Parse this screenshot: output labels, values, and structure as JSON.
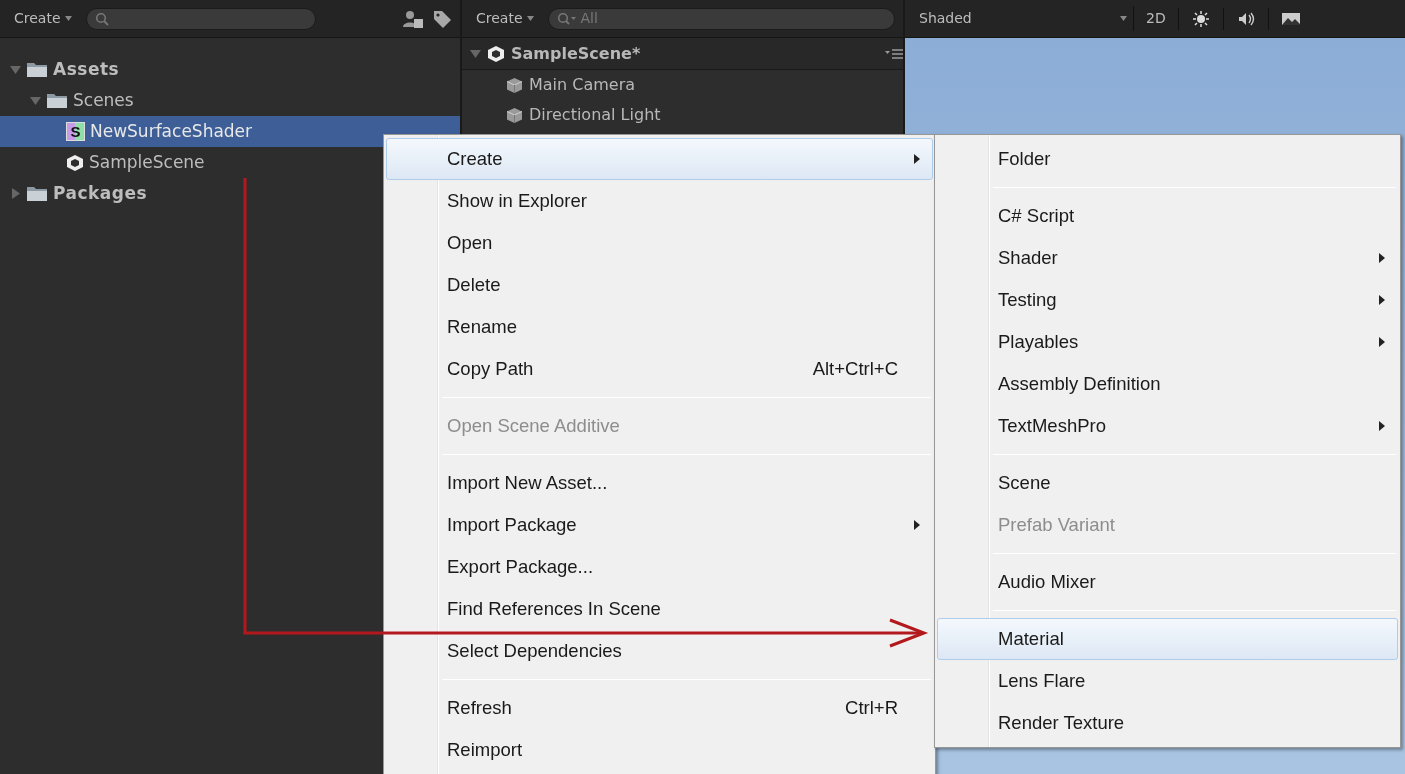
{
  "project_panel": {
    "create_button": "Create",
    "tree": [
      {
        "label": "Assets",
        "kind": "folder",
        "expanded": true,
        "selected": false,
        "children": [
          {
            "label": "Scenes",
            "kind": "folder",
            "expanded": true,
            "selected": false,
            "children": [
              {
                "label": "NewSurfaceShader",
                "kind": "shader",
                "icon_letter": "S",
                "selected": true
              },
              {
                "label": "SampleScene",
                "kind": "scene",
                "selected": false
              }
            ]
          }
        ]
      },
      {
        "label": "Packages",
        "kind": "folder",
        "expanded": false,
        "selected": false
      }
    ]
  },
  "hierarchy_panel": {
    "create_button": "Create",
    "search": {
      "placeholder": "All"
    },
    "scene": {
      "label": "SampleScene*",
      "expanded": true,
      "children": [
        {
          "label": "Main Camera"
        },
        {
          "label": "Directional Light"
        }
      ]
    }
  },
  "scene_view": {
    "draw_mode": "Shaded",
    "mode_button": "2D"
  },
  "context_menu": {
    "items": [
      {
        "kind": "item",
        "label": "Create",
        "submenu": true,
        "disabled": false,
        "selected": true
      },
      {
        "kind": "item",
        "label": "Show in Explorer",
        "submenu": false,
        "disabled": false,
        "selected": false
      },
      {
        "kind": "item",
        "label": "Open",
        "submenu": false,
        "disabled": false,
        "selected": false
      },
      {
        "kind": "item",
        "label": "Delete",
        "submenu": false,
        "disabled": false,
        "selected": false
      },
      {
        "kind": "item",
        "label": "Rename",
        "submenu": false,
        "disabled": false,
        "selected": false
      },
      {
        "kind": "item",
        "label": "Copy Path",
        "shortcut": "Alt+Ctrl+C",
        "submenu": false,
        "disabled": false,
        "selected": false
      },
      {
        "kind": "separator"
      },
      {
        "kind": "item",
        "label": "Open Scene Additive",
        "submenu": false,
        "disabled": true,
        "selected": false
      },
      {
        "kind": "separator"
      },
      {
        "kind": "item",
        "label": "Import New Asset...",
        "submenu": false,
        "disabled": false,
        "selected": false
      },
      {
        "kind": "item",
        "label": "Import Package",
        "submenu": true,
        "disabled": false,
        "selected": false
      },
      {
        "kind": "item",
        "label": "Export Package...",
        "submenu": false,
        "disabled": false,
        "selected": false
      },
      {
        "kind": "item",
        "label": "Find References In Scene",
        "submenu": false,
        "disabled": false,
        "selected": false
      },
      {
        "kind": "item",
        "label": "Select Dependencies",
        "submenu": false,
        "disabled": false,
        "selected": false
      },
      {
        "kind": "separator"
      },
      {
        "kind": "item",
        "label": "Refresh",
        "shortcut": "Ctrl+R",
        "submenu": false,
        "disabled": false,
        "selected": false
      },
      {
        "kind": "item",
        "label": "Reimport",
        "submenu": false,
        "disabled": false,
        "selected": false
      }
    ]
  },
  "create_submenu": {
    "items": [
      {
        "kind": "item",
        "label": "Folder",
        "submenu": false,
        "disabled": false,
        "selected": false
      },
      {
        "kind": "separator"
      },
      {
        "kind": "item",
        "label": "C# Script",
        "submenu": false,
        "disabled": false,
        "selected": false
      },
      {
        "kind": "item",
        "label": "Shader",
        "submenu": true,
        "disabled": false,
        "selected": false
      },
      {
        "kind": "item",
        "label": "Testing",
        "submenu": true,
        "disabled": false,
        "selected": false
      },
      {
        "kind": "item",
        "label": "Playables",
        "submenu": true,
        "disabled": false,
        "selected": false
      },
      {
        "kind": "item",
        "label": "Assembly Definition",
        "submenu": false,
        "disabled": false,
        "selected": false
      },
      {
        "kind": "item",
        "label": "TextMeshPro",
        "submenu": true,
        "disabled": false,
        "selected": false
      },
      {
        "kind": "separator"
      },
      {
        "kind": "item",
        "label": "Scene",
        "submenu": false,
        "disabled": false,
        "selected": false
      },
      {
        "kind": "item",
        "label": "Prefab Variant",
        "submenu": false,
        "disabled": true,
        "selected": false
      },
      {
        "kind": "separator"
      },
      {
        "kind": "item",
        "label": "Audio Mixer",
        "submenu": false,
        "disabled": false,
        "selected": false
      },
      {
        "kind": "separator"
      },
      {
        "kind": "item",
        "label": "Material",
        "submenu": false,
        "disabled": false,
        "selected": true
      },
      {
        "kind": "item",
        "label": "Lens Flare",
        "submenu": false,
        "disabled": false,
        "selected": false
      },
      {
        "kind": "item",
        "label": "Render Texture",
        "submenu": false,
        "disabled": false,
        "selected": false
      }
    ]
  }
}
